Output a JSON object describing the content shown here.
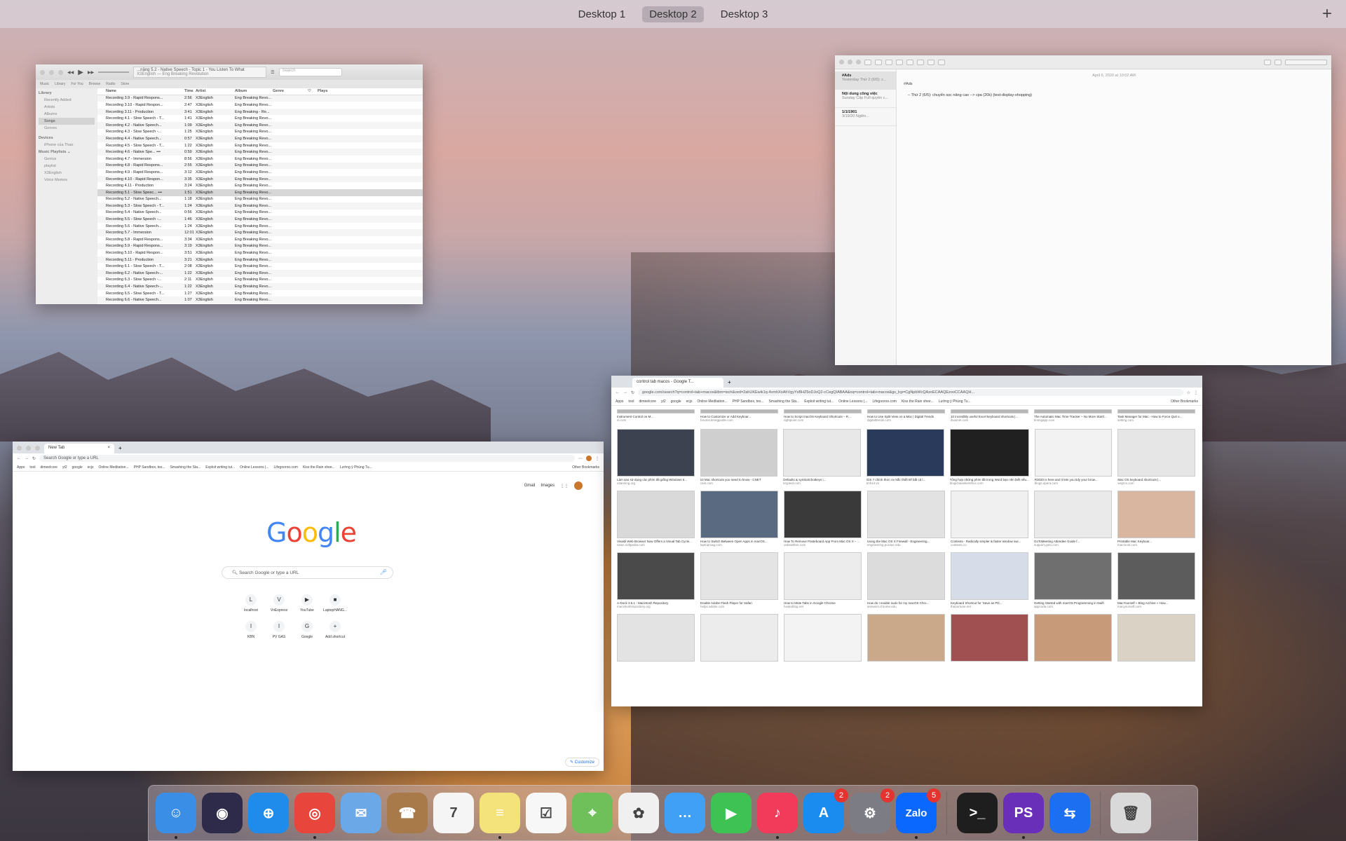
{
  "spaces": {
    "tabs": [
      "Desktop 1",
      "Desktop 2",
      "Desktop 3"
    ],
    "active_index": 1,
    "add_label": "+"
  },
  "itunes": {
    "lcd_title": "...nâng 5.2 - Native Speech - Topic 1 - You Listen To What",
    "lcd_sub": "X3English — Eng Breaking Revolution",
    "search_placeholder": "Search",
    "view_tabs": [
      "Library",
      "For You",
      "Browse",
      "Radio",
      "Store"
    ],
    "media_select": "Music",
    "sidebar": {
      "library_header": "Library",
      "library": [
        "Recently Added",
        "Artists",
        "Albums",
        "Songs",
        "Genres"
      ],
      "devices_header": "Devices",
      "devices": [
        "iPhone của Thao"
      ],
      "playlists_header": "Music Playlists ⌄",
      "playlists": [
        "Genius",
        "playlist",
        "X3English",
        "Voice Memos"
      ]
    },
    "columns": [
      "Name",
      "Time",
      "Artist",
      "Album",
      "Genre",
      "♡",
      "Plays"
    ],
    "rows": [
      [
        "Recording 3.9 - Rapid Respons...",
        "2:56",
        "X3English",
        "Eng Breaking Revo..."
      ],
      [
        "Recording 3.10 - Rapid Respon...",
        "2:47",
        "X3English",
        "Eng Breaking Revo..."
      ],
      [
        "Recording 3.11 - Production",
        "3:41",
        "X3English",
        "Eng Breaking - Re..."
      ],
      [
        "Recording 4.1 - Slow Speech - T...",
        "1:41",
        "X3English",
        "Eng Breaking Revo..."
      ],
      [
        "Recording 4.2 - Native Speech...",
        "1:09",
        "X3English",
        "Eng Breaking Revo..."
      ],
      [
        "Recording 4.3 - Slow Speech -...",
        "1:25",
        "X3English",
        "Eng Breaking Revo..."
      ],
      [
        "Recording 4.4 - Native Speech...",
        "0:57",
        "X3English",
        "Eng Breaking Revo..."
      ],
      [
        "Recording 4.5 - Slow Speech - T...",
        "1:22",
        "X3English",
        "Eng Breaking Revo..."
      ],
      [
        "Recording 4.6 - Native Spe... •••",
        "0:59",
        "X3English",
        "Eng Breaking Revo..."
      ],
      [
        "Recording 4.7 - Immersion",
        "8:56",
        "X3English",
        "Eng Breaking Revo..."
      ],
      [
        "Recording 4.8 - Rapid Respons...",
        "2:55",
        "X3English",
        "Eng Breaking Revo..."
      ],
      [
        "Recording 4.9 - Rapid Respons...",
        "3:12",
        "X3English",
        "Eng Breaking Revo..."
      ],
      [
        "Recording 4.10 - Rapid Respon...",
        "3:35",
        "X3English",
        "Eng Breaking Revo..."
      ],
      [
        "Recording 4.11 - Production",
        "3:24",
        "X3English",
        "Eng Breaking Revo..."
      ],
      [
        "Recording 5.1 - Slow Speec... •••",
        "1:51",
        "X3English",
        "Eng Breaking Revo..."
      ],
      [
        "Recording 5.2 - Native Speech...",
        "1:18",
        "X3English",
        "Eng Breaking Revo..."
      ],
      [
        "Recording 5.3 - Slow Speech - T...",
        "1:24",
        "X3English",
        "Eng Breaking Revo..."
      ],
      [
        "Recording 5.4 - Native Speech...",
        "0:56",
        "X3English",
        "Eng Breaking Revo..."
      ],
      [
        "Recording 5.5 - Slow Speech -...",
        "1:46",
        "X3English",
        "Eng Breaking Revo..."
      ],
      [
        "Recording 5.6 - Native Speech...",
        "1:24",
        "X3English",
        "Eng Breaking Revo..."
      ],
      [
        "Recording 5.7 - Immersion",
        "12:01",
        "X3English",
        "Eng Breaking Revo..."
      ],
      [
        "Recording 5.8 - Rapid Respons...",
        "3:34",
        "X3English",
        "Eng Breaking Revo..."
      ],
      [
        "Recording 5.9 - Rapid Respons...",
        "3:19",
        "X3English",
        "Eng Breaking Revo..."
      ],
      [
        "Recording 5.10 - Rapid Respon...",
        "3:51",
        "X3English",
        "Eng Breaking Revo..."
      ],
      [
        "Recording 5.11 - Production",
        "3:21",
        "X3English",
        "Eng Breaking Revo..."
      ],
      [
        "Recording 6.1 - Slow Speech - T...",
        "2:08",
        "X3English",
        "Eng Breaking Revo..."
      ],
      [
        "Recording 6.2 - Native Speech-...",
        "1:22",
        "X3English",
        "Eng Breaking Revo..."
      ],
      [
        "Recording 6.3 - Slow Speech -...",
        "2:11",
        "X3English",
        "Eng Breaking Revo..."
      ],
      [
        "Recording 6.4 - Native Speech-...",
        "1:22",
        "X3English",
        "Eng Breaking Revo..."
      ],
      [
        "Recording 6.5 - Slow Speech - T...",
        "1:27",
        "X3English",
        "Eng Breaking Revo..."
      ],
      [
        "Recording 6.6 - Native Speech...",
        "1:07",
        "X3English",
        "Eng Breaking Revo..."
      ]
    ]
  },
  "notes": {
    "list": [
      {
        "title": "#Ads",
        "date": "Yesterday",
        "preview": "Thứ 2 (6/5): c..."
      },
      {
        "title": "Nội dung công việc",
        "date": "Sunday",
        "preview": "Cấp Full quyền c..."
      },
      {
        "title": "1/1/1901",
        "date": "3/19/20",
        "preview": "Ngiên..."
      }
    ],
    "content_date": "April 6, 2020 at 10:02 AM",
    "content_heading": "#Ads",
    "content_bullet": "Thứ 2 (6/5): chuyển sọc nâng cao --> cpa (20k) (test-display-shopping)"
  },
  "chrome_newtab": {
    "tab_title": "New Tab",
    "omnibox_placeholder": "Search Google or type a URL",
    "bookmarks": [
      "Apps",
      "tool",
      "dimeelcore",
      "yt2",
      "google",
      "ecjs",
      "Online Meditation...",
      "PHP Sandbox, tes...",
      "Smashing the Sta...",
      "Exploit writing tut...",
      "Online Lessons |...",
      "Lifegooroo.com",
      "Kiss the Rain shee...",
      "Lường ý Phùng Tu..."
    ],
    "other_bookmarks": "Other Bookmarks",
    "top_links": [
      "Gmail",
      "Images"
    ],
    "logo": "Google",
    "search_placeholder": "Search Google or type a URL",
    "shortcuts": [
      {
        "label": "localhost",
        "glyph": "L"
      },
      {
        "label": "VnExpress",
        "glyph": "V"
      },
      {
        "label": "YouTube",
        "glyph": "▶"
      },
      {
        "label": "LaptopHANG...",
        "glyph": "■"
      },
      {
        "label": "",
        "glyph": ""
      },
      {
        "label": "KBN",
        "glyph": "I"
      },
      {
        "label": "PV GAS",
        "glyph": "I"
      },
      {
        "label": "Google",
        "glyph": "G"
      },
      {
        "label": "Add shortcut",
        "glyph": "+"
      },
      {
        "label": "",
        "glyph": ""
      }
    ],
    "customize_label": "✎ Customize"
  },
  "chrome_images": {
    "tab_title": "control tab macos - Google T...",
    "url": "google.com/search?q=control+tab+macos&tbm=isch&ved=2ahUKEwik1q-4vmhXoAhVgyYsBHZ5oDJoQ2-cCegQIABAA&oq=control+tab+macos&gs_lcp=CgNpbWcQAzoECAAQEzooCCAAQH...",
    "bookmarks": [
      "Apps",
      "tool",
      "dimeelcore",
      "yt2",
      "google",
      "ecjs",
      "Online Meditation...",
      "PHP Sandbox, tes...",
      "Smashing the Sta...",
      "Exploit writing tut...",
      "Online Lessons |...",
      "Lifegooroo.com",
      "Kiss the Rain shee...",
      "Lường ý Phùng Tu..."
    ],
    "other_bookmarks": "Other Bookmarks",
    "top_strip": [
      {
        "cap": "Instrument Control on M...",
        "src": "ni.com"
      },
      {
        "cap": "How to Customize or Add Keyboar...",
        "src": "forums.lenegpodle.com"
      },
      {
        "cap": "How to Script macOS Keyboard Shortcuts – R...",
        "src": "rightpoint.com"
      },
      {
        "cap": "How to Use Split View on a Mac | Digital Trends",
        "src": "digitaltrends.com"
      },
      {
        "cap": "10 incredibly useful Excel keyboard shortcuts |...",
        "src": "ibusinet.com"
      },
      {
        "cap": "The Automatic Mac Time Tracker – No More Start/...",
        "src": "timingapp.com"
      },
      {
        "cap": "Task Manager for Mac - How to Force Quit o...",
        "src": "setting.com"
      }
    ],
    "rows": [
      [
        {
          "cap": "Làm sao sử dụng các phím tắt giống Windows tr...",
          "src": "x3anning.org",
          "tone": "#3d4250"
        },
        {
          "cap": "10 Mac shortcuts you need to know - CNET",
          "src": "cnet.com",
          "tone": "#cfcfcf"
        },
        {
          "cap": "Defaults & symbolichotkeys i...",
          "src": "krypted.com",
          "tone": "#e8e8e8"
        },
        {
          "cap": "iOS 7 chính thức ra mắt: thiết kế bắt cả l...",
          "src": "tinh14.vn",
          "tone": "#2a3a5a"
        },
        {
          "cap": "Tổng hợp những phím tắt trong Word bạn nên biết nếu...",
          "src": "blogchiasekienthuc.com",
          "tone": "#202020"
        },
        {
          "cap": "R3020 is here and it lets you tidy your brow...",
          "src": "blogs.opera.com",
          "tone": "#f2f2f2"
        },
        {
          "cap": "Mac OS keyboard shortcuts |...",
          "src": "wsj2cs.com",
          "tone": "#e6e6e6"
        }
      ],
      [
        {
          "cap": "Vivaldi Web Browser Now Offers a Visual Tab Cycle...",
          "src": "news.softpedia.com",
          "tone": "#d9d9d9"
        },
        {
          "cap": "How to Switch Between Open Apps in macOS...",
          "src": "laptopmag.com",
          "tone": "#5a6a80"
        },
        {
          "cap": "How To Remove Pasteboard App From Mac OS X – ...",
          "src": "unbeatfree.com",
          "tone": "#3a3a3a"
        },
        {
          "cap": "Using the Mac OS X Firewall - Engineering...",
          "src": "engineering.purdue.edu",
          "tone": "#e2e2e2"
        },
        {
          "cap": "Contexts - Radically simpler & faster window swi...",
          "src": "contexts.co",
          "tone": "#f0f0f0"
        },
        {
          "cap": "GoToMeeting Attendee Guide f...",
          "src": "support.goto.com",
          "tone": "#eaeaea"
        },
        {
          "cap": "Printable Mac Keyboar...",
          "src": "macmost.com",
          "tone": "#d8b6a0"
        }
      ],
      [
        {
          "cap": "A-Dock 3.5.1 - Macintosh Repository",
          "src": "macintoshrepository.org",
          "tone": "#4a4a4a"
        },
        {
          "cap": "Enable Adobe Flash Player for Safari",
          "src": "helpx.adobe.com",
          "tone": "#e4e4e4"
        },
        {
          "cap": "How to Mute Tabs in Google Chrome",
          "src": "howtoblog.net",
          "tone": "#ececec"
        },
        {
          "cap": "How do I enable sudo for my macOS Chro...",
          "src": "answers.chrome.edu",
          "tone": "#dcdcdc"
        },
        {
          "cap": "Keyboard Shortcut for 'Save as PD...",
          "src": "theportune.net",
          "tone": "#d7dde8"
        },
        {
          "cap": "Getting Started with macOS Programming in Swift",
          "src": "appcoda.com",
          "tone": "#6f6f6f"
        },
        {
          "cap": "MacYourself » Blog Archive » How...",
          "src": "macyourself.com",
          "tone": "#5c5c5c"
        }
      ],
      [
        {
          "cap": "",
          "src": "",
          "tone": "#e3e3e3"
        },
        {
          "cap": "",
          "src": "",
          "tone": "#ececec"
        },
        {
          "cap": "",
          "src": "",
          "tone": "#f3f3f3"
        },
        {
          "cap": "",
          "src": "",
          "tone": "#caa98a"
        },
        {
          "cap": "",
          "src": "",
          "tone": "#a05050"
        },
        {
          "cap": "",
          "src": "",
          "tone": "#c79a7a"
        },
        {
          "cap": "",
          "src": "",
          "tone": "#d9d2c5"
        }
      ]
    ]
  },
  "dock": {
    "items": [
      {
        "name": "finder",
        "glyph": "☺",
        "color": "#3a8ee6",
        "badge": "",
        "running": true
      },
      {
        "name": "siri",
        "glyph": "◉",
        "color": "#2e2a4a",
        "badge": "",
        "running": false
      },
      {
        "name": "safari",
        "glyph": "⊕",
        "color": "#1f8ceb",
        "badge": "",
        "running": false
      },
      {
        "name": "chrome",
        "glyph": "◎",
        "color": "#e8453c",
        "badge": "",
        "running": true
      },
      {
        "name": "mail",
        "glyph": "✉",
        "color": "#6aa8e8",
        "badge": "",
        "running": false
      },
      {
        "name": "contacts",
        "glyph": "☎",
        "color": "#a87a4a",
        "badge": "",
        "running": false
      },
      {
        "name": "calendar",
        "glyph": "7",
        "color": "#f5f5f5",
        "badge": "",
        "running": false
      },
      {
        "name": "notes",
        "glyph": "≡",
        "color": "#f4e27a",
        "badge": "",
        "running": true
      },
      {
        "name": "reminders",
        "glyph": "☑",
        "color": "#f7f7f7",
        "badge": "",
        "running": false
      },
      {
        "name": "maps",
        "glyph": "⌖",
        "color": "#6fbf5a",
        "badge": "",
        "running": false
      },
      {
        "name": "photos",
        "glyph": "✿",
        "color": "#f0f0f0",
        "badge": "",
        "running": false
      },
      {
        "name": "messages",
        "glyph": "…",
        "color": "#3fa0f5",
        "badge": "",
        "running": false
      },
      {
        "name": "facetime",
        "glyph": "▶",
        "color": "#3ec253",
        "badge": "",
        "running": false
      },
      {
        "name": "music",
        "glyph": "♪",
        "color": "#f23b5a",
        "badge": "",
        "running": true
      },
      {
        "name": "app-store",
        "glyph": "A",
        "color": "#1a8cf0",
        "badge": "2",
        "running": false
      },
      {
        "name": "system-preferences",
        "glyph": "⚙",
        "color": "#7c7c84",
        "badge": "2",
        "running": false
      },
      {
        "name": "zalo",
        "glyph": "Zalo",
        "color": "#0a68ff",
        "badge": "5",
        "running": true
      },
      {
        "name": "terminal",
        "glyph": ">_",
        "color": "#1e1e1e",
        "badge": "",
        "running": false
      },
      {
        "name": "phpstorm",
        "glyph": "PS",
        "color": "#6a2fb8",
        "badge": "",
        "running": true
      },
      {
        "name": "teamviewer",
        "glyph": "⇆",
        "color": "#1d6ff2",
        "badge": "",
        "running": false
      },
      {
        "name": "trash",
        "glyph": "🗑",
        "color": "#d9d9d9",
        "badge": "",
        "running": false
      }
    ]
  }
}
